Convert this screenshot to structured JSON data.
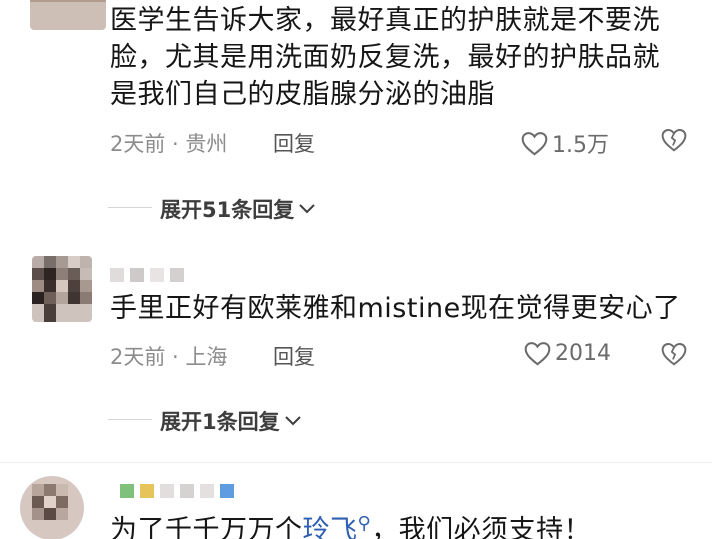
{
  "comments": [
    {
      "lines": [
        "医学生告诉大家，最好真正的护肤就是不要洗",
        "脸，尤其是用洗面奶反复洗，最好的护肤品就",
        "是我们自己的皮脂腺分泌的油脂"
      ],
      "meta": "2天前 · 贵州",
      "reply_label": "回复",
      "likes": "1.5万",
      "expand_label": "展开51条回复"
    },
    {
      "text": "手里正好有欧莱雅和mistine现在觉得更安心了",
      "meta": "2天前 · 上海",
      "reply_label": "回复",
      "likes": "2014",
      "expand_label": "展开1条回复"
    },
    {
      "text_before": "为了千千万万个",
      "link_word": "玲飞",
      "text_after": "，我们必须支持！"
    }
  ],
  "icons": {
    "like": "heart-outline-icon",
    "dislike": "broken-heart-icon",
    "expand": "chevron-down-icon",
    "search": "search-icon"
  },
  "colors": {
    "text": "#161616",
    "meta": "#8c8c8c",
    "link": "#2f5fb3"
  }
}
